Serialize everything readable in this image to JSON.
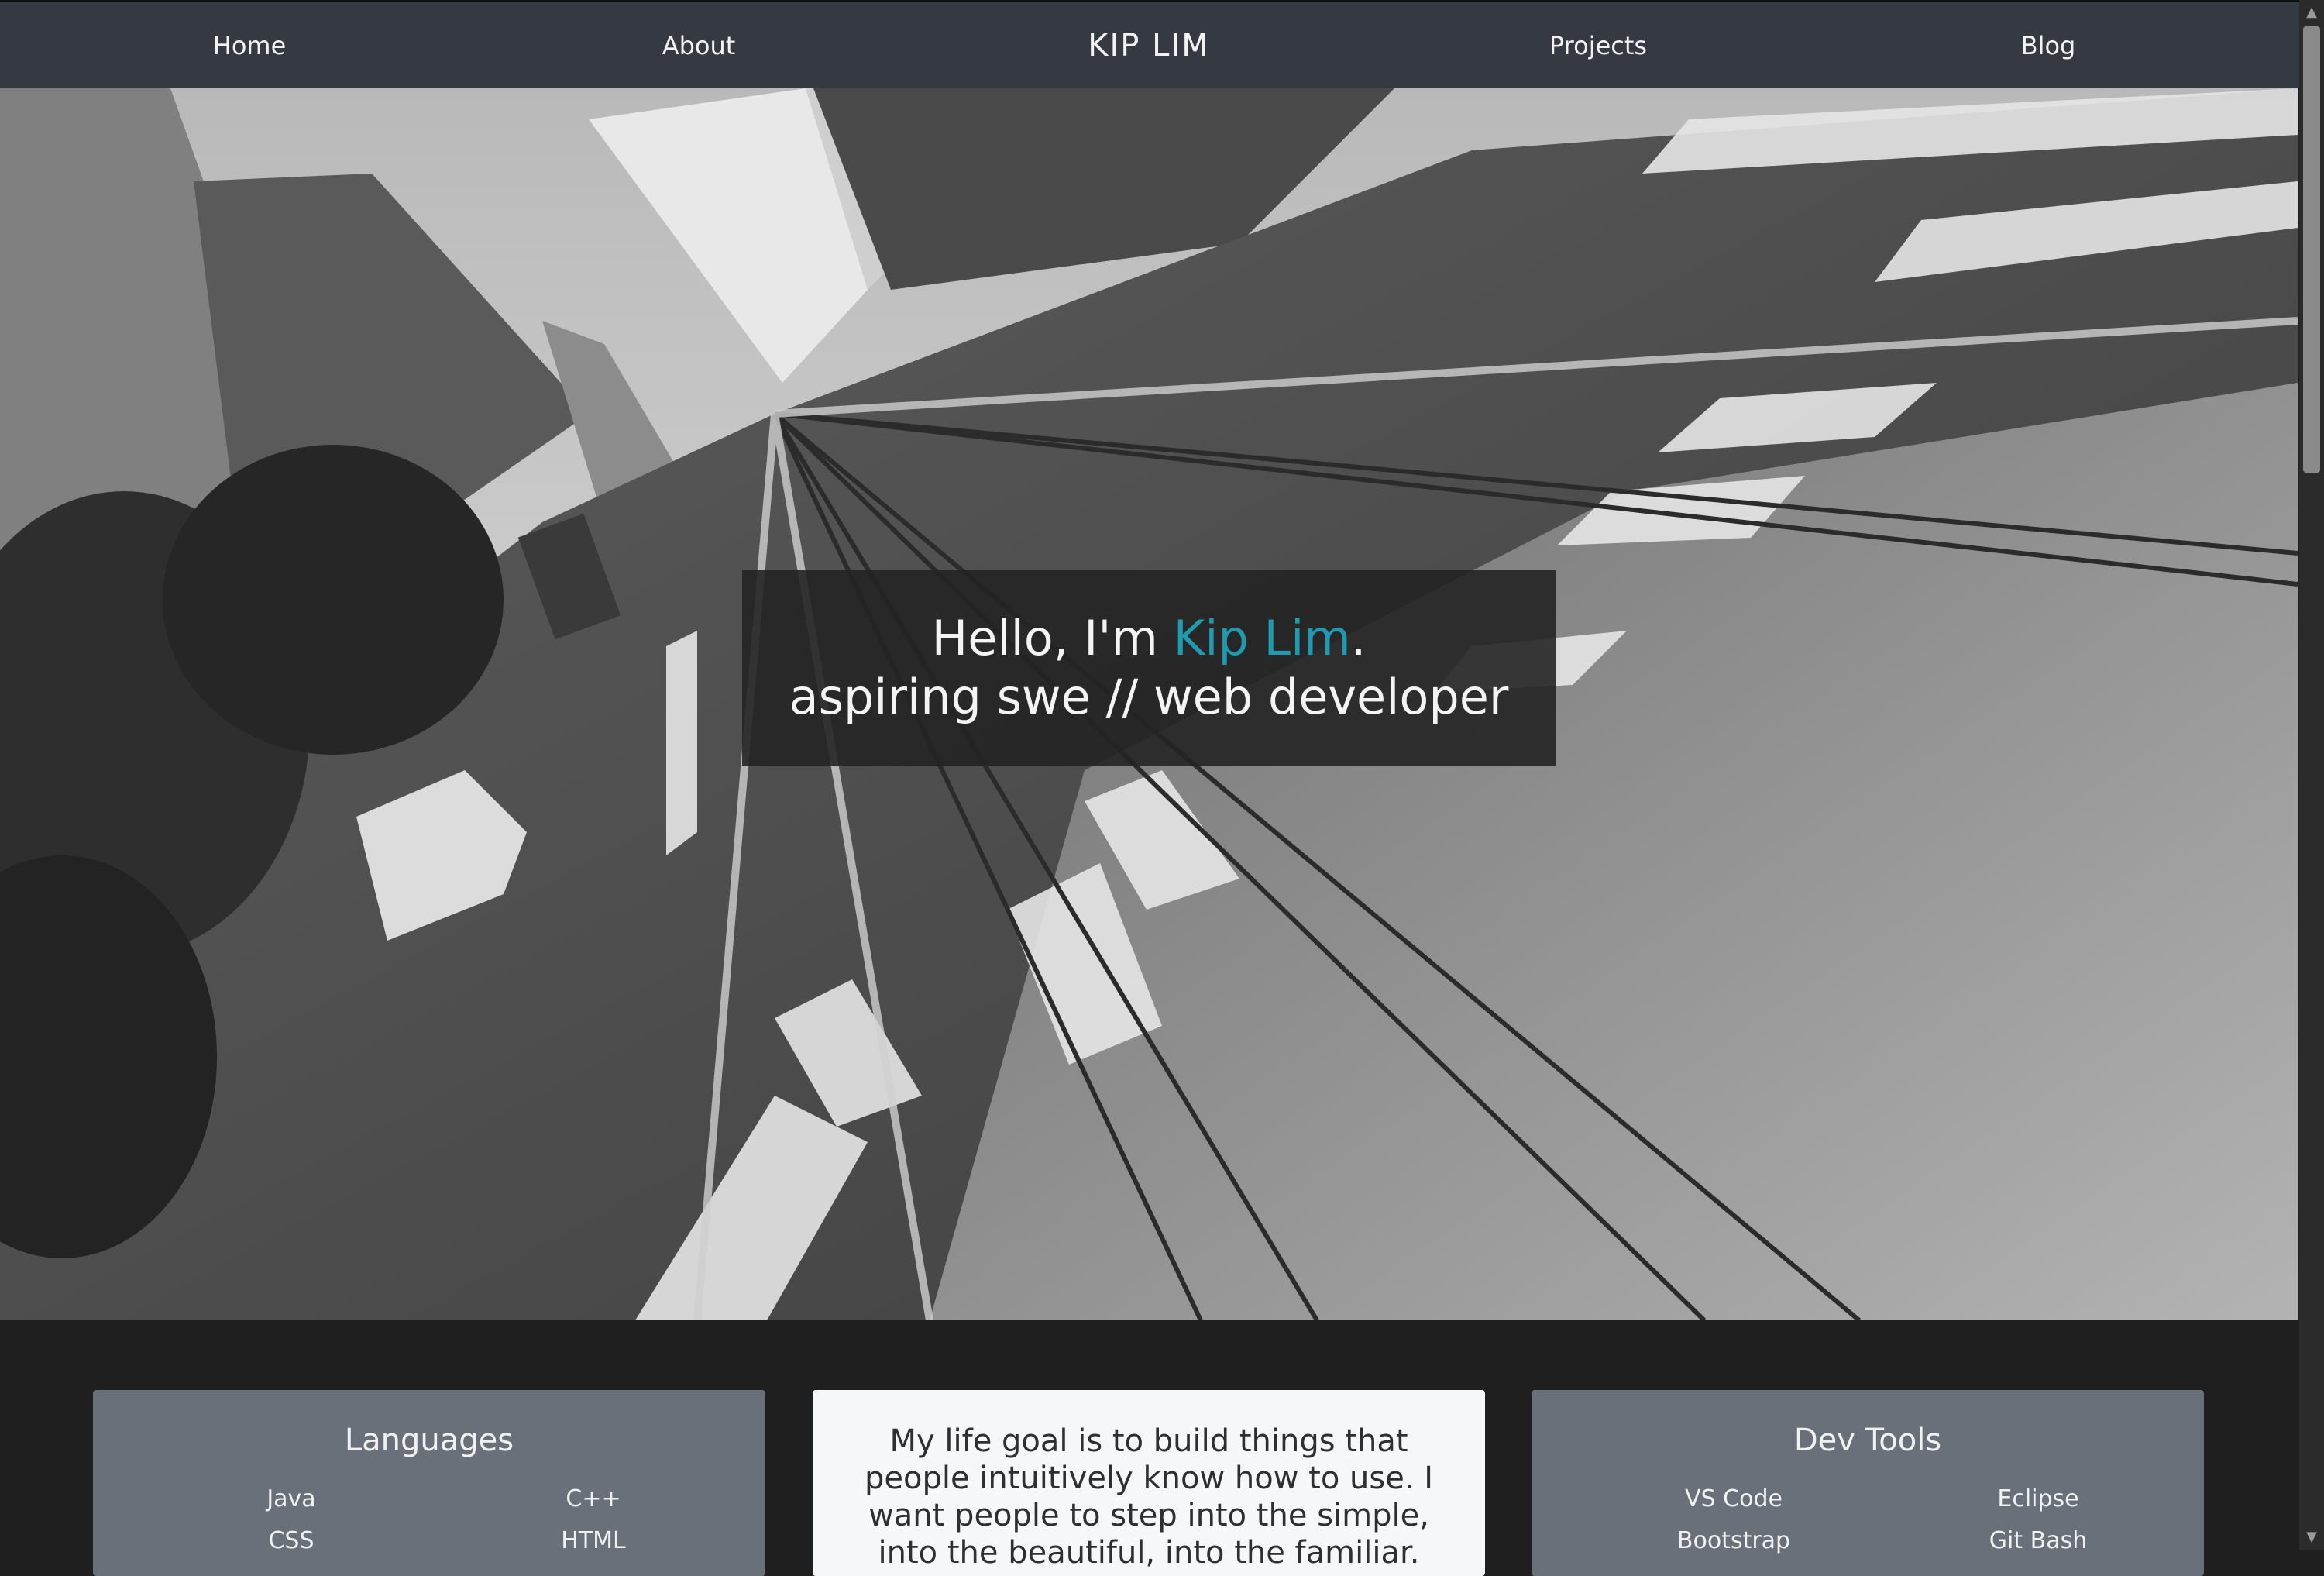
{
  "nav": {
    "home": "Home",
    "about": "About",
    "brand": "KIP LIM",
    "projects": "Projects",
    "blog": "Blog"
  },
  "hero": {
    "greeting": "Hello, I'm ",
    "name": "Kip Lim",
    "period": ".",
    "tagline": "aspiring swe // web developer"
  },
  "languages": {
    "title": "Languages",
    "items": [
      "Java",
      "C++",
      "CSS",
      "HTML"
    ]
  },
  "about_quote": "My life goal is to build things that people intuitively know how to use. I want people to step into the simple, into the beautiful, into the familiar.",
  "dev_tools": {
    "title": "Dev Tools",
    "items": [
      "VS Code",
      "Eclipse",
      "Bootstrap",
      "Git Bash"
    ]
  },
  "colors": {
    "nav_bg": "#353a42",
    "accent": "#1f9bb0",
    "page_bg": "#1f1f20",
    "card_gray": "#69707a",
    "card_white": "#f6f7f8"
  }
}
